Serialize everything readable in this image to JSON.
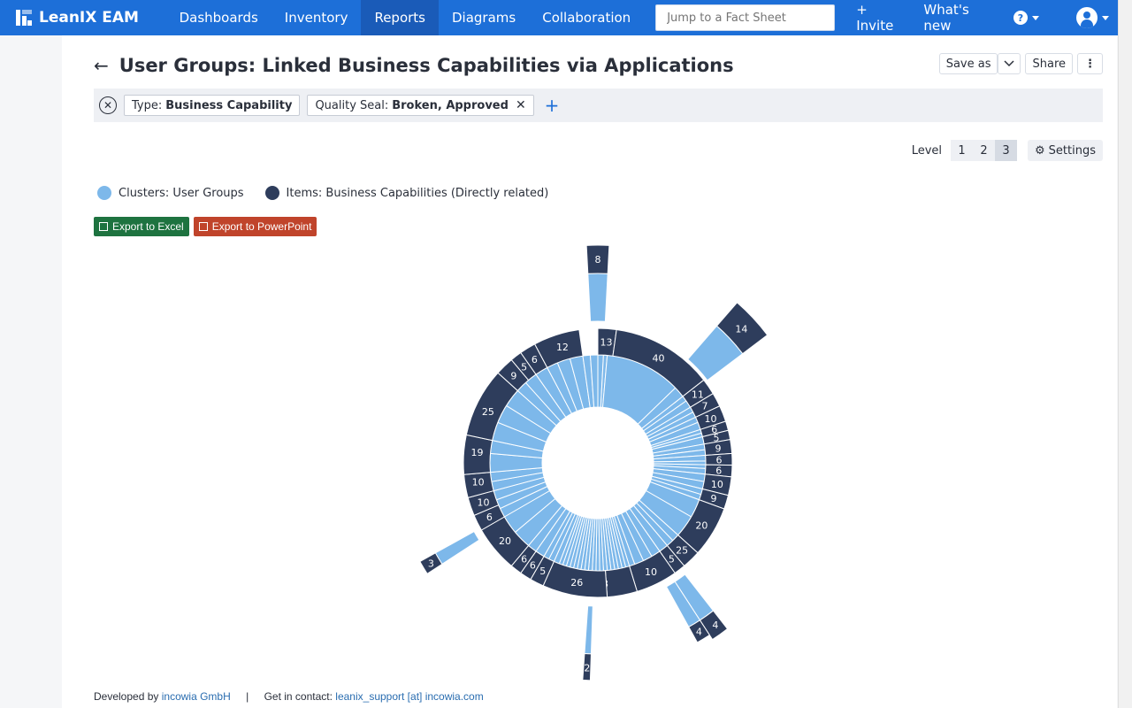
{
  "brand": {
    "name": "LeanIX EAM"
  },
  "nav": [
    {
      "label": "Dashboards",
      "active": false
    },
    {
      "label": "Inventory",
      "active": false
    },
    {
      "label": "Reports",
      "active": true
    },
    {
      "label": "Diagrams",
      "active": false
    },
    {
      "label": "Collaboration",
      "active": false
    }
  ],
  "search": {
    "placeholder": "Jump to a Fact Sheet"
  },
  "top_right": {
    "invite": "+ Invite",
    "whats_new": "What's new",
    "help_icon": "question-icon",
    "user_icon": "user-icon"
  },
  "page": {
    "title": "User Groups: Linked Business Capabilities via Applications",
    "save_as": "Save as",
    "share": "Share",
    "more": "⋮"
  },
  "filters": [
    {
      "key": "Type:",
      "value": "Business Capability",
      "removable": false
    },
    {
      "key": "Quality Seal:",
      "value": "Broken, Approved",
      "removable": true
    }
  ],
  "level": {
    "label": "Level",
    "options": [
      "1",
      "2",
      "3"
    ],
    "active": "3",
    "settings": "Settings"
  },
  "legend": [
    {
      "label": "Clusters: User Groups",
      "color": "#7db8ea"
    },
    {
      "label": "Items: Business Capabilities (Directly related)",
      "color": "#2e3d5c"
    }
  ],
  "exports": [
    {
      "label": "Export to Excel",
      "color": "#1e7340"
    },
    {
      "label": "Export to PowerPoint",
      "color": "#c0442b"
    }
  ],
  "footer": {
    "developed_by": "Developed by",
    "company": "incowia GmbH",
    "separator": "|",
    "contact_label": "Get in contact:",
    "contact": "leanix_support [at] incowia.com"
  },
  "chart_data": {
    "type": "sunburst",
    "inner_ring": "Clusters: User Groups",
    "outer_ring": "Items: Business Capabilities (Directly related)",
    "outer_labels": [
      "13",
      "40",
      "11",
      "7",
      "10",
      "6",
      "5",
      "9",
      "6",
      "6",
      "10",
      "9",
      "20",
      "25",
      "5",
      "10",
      "8",
      "26",
      "5",
      "6",
      "6",
      "20",
      "6",
      "10",
      "10",
      "19",
      "25",
      "9",
      "5",
      "6",
      "12"
    ],
    "extended_labels": [
      "8",
      "14",
      "4",
      "4",
      "2",
      "3"
    ]
  }
}
